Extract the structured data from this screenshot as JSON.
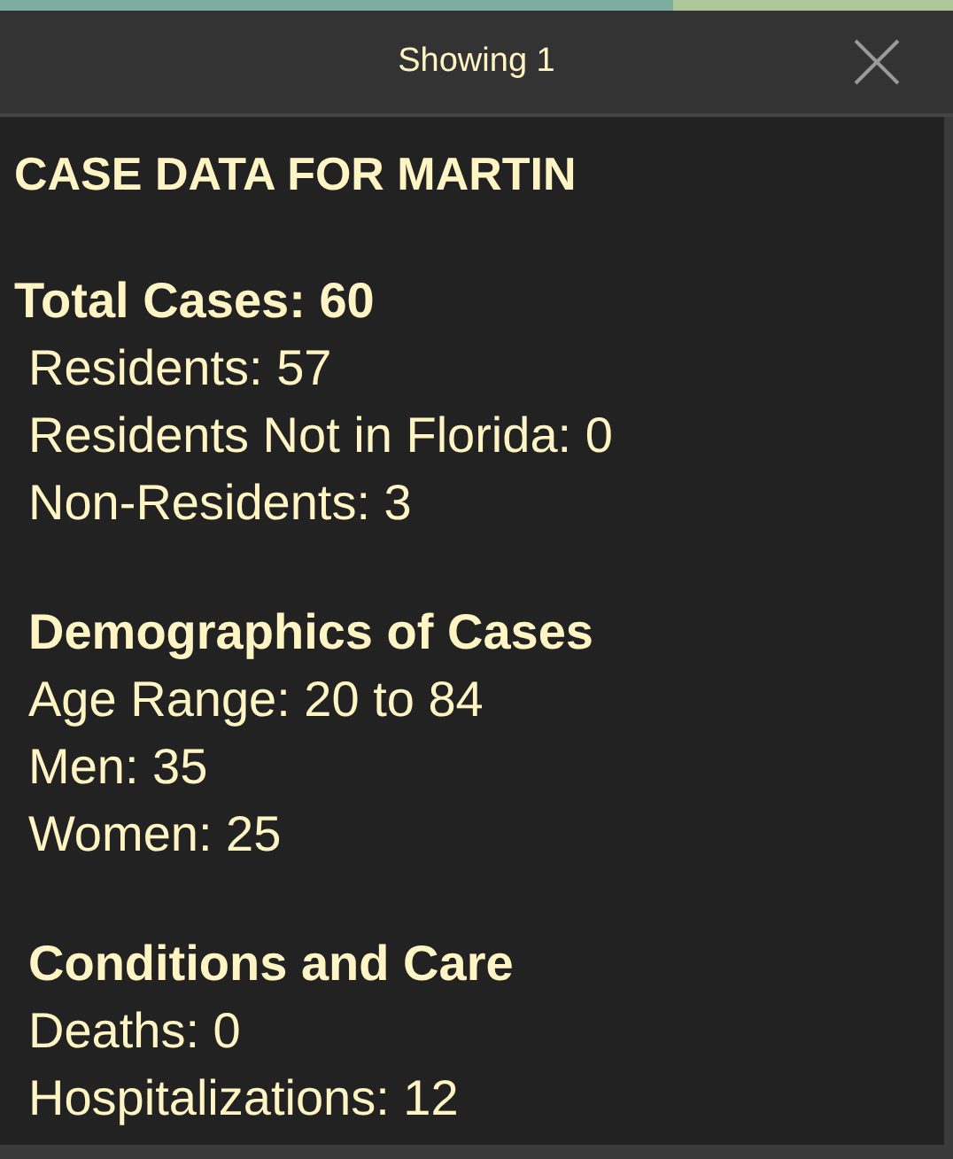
{
  "header": {
    "title": "Showing 1"
  },
  "content": {
    "title": "CASE DATA FOR MARTIN",
    "sections": [
      {
        "kind": "total",
        "heading": "Total Cases: 60",
        "lines": [
          "Residents: 57",
          "Residents Not in Florida: 0",
          "Non-Residents: 3"
        ]
      },
      {
        "kind": "group",
        "heading": "Demographics of Cases",
        "lines": [
          "Age Range: 20 to 84",
          "Men: 35",
          "Women: 25"
        ]
      },
      {
        "kind": "group",
        "heading": "Conditions and Care",
        "lines": [
          "Deaths: 0",
          "Hospitalizations: 12"
        ]
      }
    ]
  }
}
